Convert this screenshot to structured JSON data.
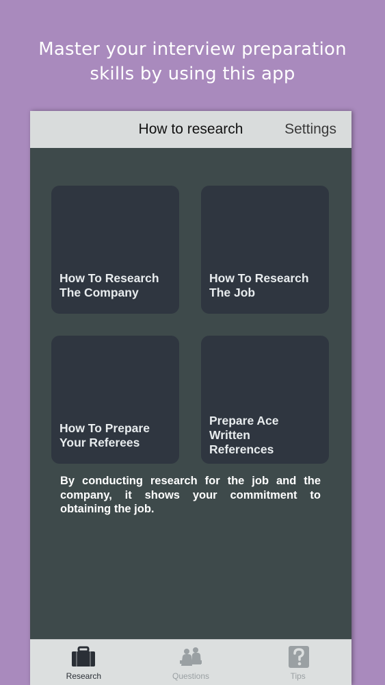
{
  "promo": {
    "headline_line1": "Master your interview preparation",
    "headline_line2": "skills by using this app"
  },
  "navbar": {
    "title": "How to research",
    "settings_label": "Settings"
  },
  "tiles": [
    {
      "label": "How To Research\nThe Company"
    },
    {
      "label": "How To Research\nThe Job"
    },
    {
      "label": "How To Prepare\nYour Referees"
    },
    {
      "label": "Prepare Ace\nWritten\nReferences"
    }
  ],
  "description": "By conducting research for the job and the company, it shows your commitment to obtaining the job.",
  "tabbar": {
    "active_tab": "Research",
    "tabs": [
      {
        "label": "Research",
        "icon": "briefcase-icon"
      },
      {
        "label": "Questions",
        "icon": "people-icon"
      },
      {
        "label": "Tips",
        "icon": "question-icon"
      }
    ]
  },
  "colors": {
    "background": "#a98abd",
    "screen": "#3e4a4b",
    "tile": "#2f3640",
    "bar": "#d9dcdc",
    "active_tab": "#2a2f36",
    "inactive_tab": "#9aa0a3"
  }
}
